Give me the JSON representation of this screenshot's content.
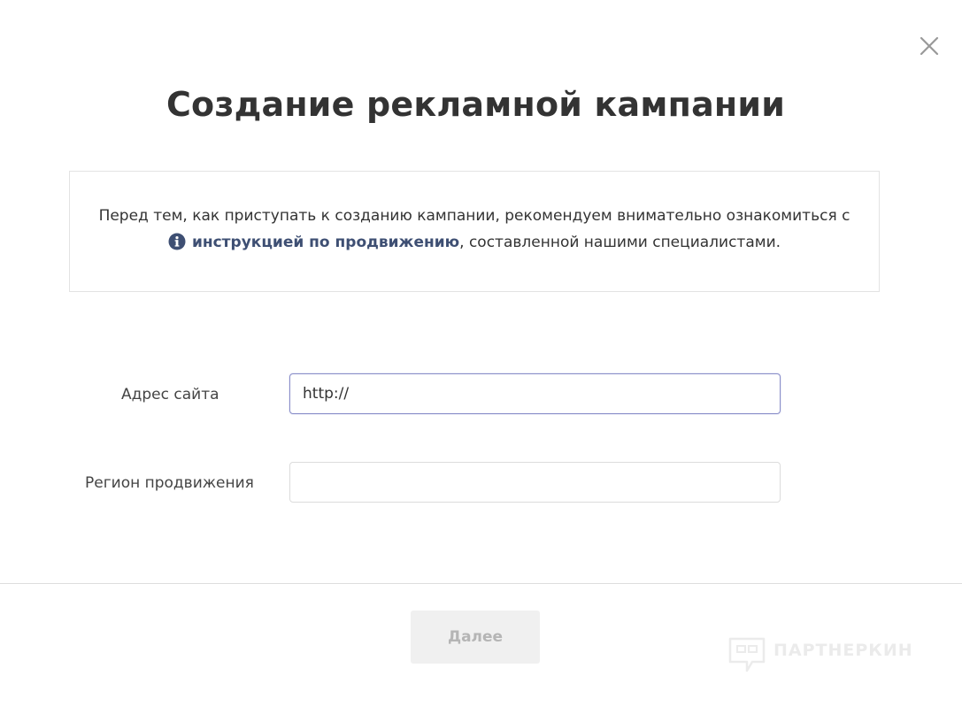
{
  "dialog": {
    "title": "Создание рекламной кампании",
    "close_icon": "close-icon"
  },
  "notice": {
    "line1": "Перед тем, как приступать к созданию кампании, рекомендуем внимательно ознакомиться с",
    "info_icon": "info-circle-icon",
    "link_text": "инструкцией по продвижению",
    "line2_suffix": ", составленной нашими специалистами.",
    "link_color": "#3e4f73"
  },
  "form": {
    "site_label": "Адрес сайта",
    "site_value": "http://",
    "region_label": "Регион продвижения",
    "region_value": ""
  },
  "footer": {
    "next_label": "Далее"
  },
  "watermark": {
    "text": "ПАРТНЕРКИН"
  }
}
